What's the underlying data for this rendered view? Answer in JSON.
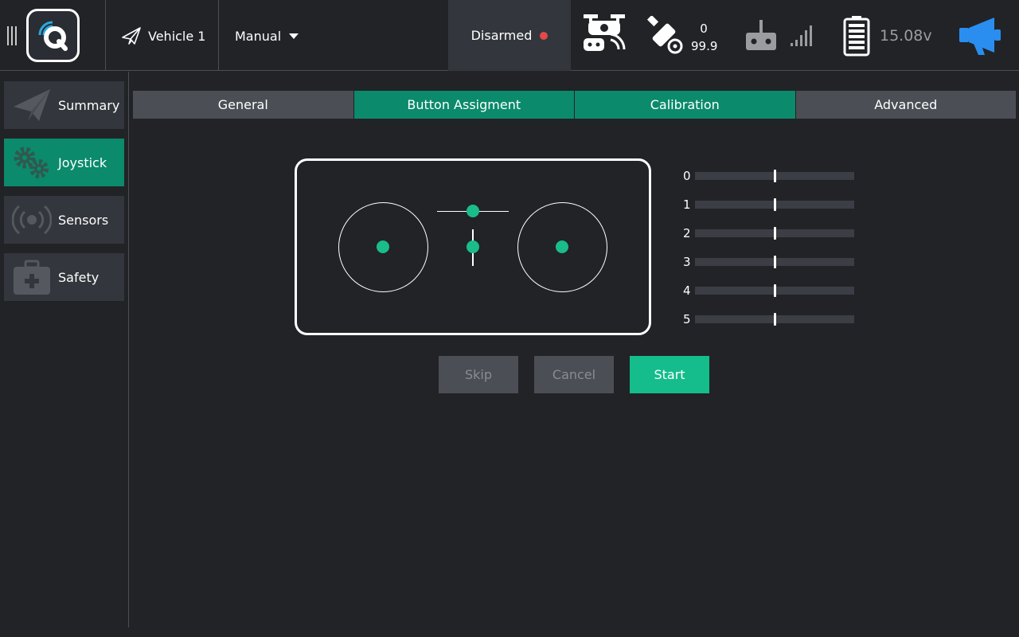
{
  "toolbar": {
    "vehicle_label": "Vehicle 1",
    "mode_label": "Manual",
    "armed_label": "Disarmed",
    "gps_count": "0",
    "gps_hdop": "99.9",
    "battery_voltage": "15.08v",
    "icons": [
      "menu-icon",
      "qgc-logo-icon",
      "paper-plane-icon",
      "dropdown-arrow-icon",
      "status-dot-icon",
      "drone-controller-icon",
      "gps-satellite-icon",
      "rc-transmitter-icon",
      "signal-bars-icon",
      "battery-icon",
      "megaphone-icon"
    ]
  },
  "sidebar": {
    "items": [
      {
        "label": "Summary",
        "icon": "paper-plane-icon",
        "active": false
      },
      {
        "label": "Joystick",
        "icon": "gears-icon",
        "active": true
      },
      {
        "label": "Sensors",
        "icon": "sensor-waves-icon",
        "active": false
      },
      {
        "label": "Safety",
        "icon": "medkit-icon",
        "active": false
      }
    ]
  },
  "tabs": [
    {
      "label": "General",
      "selected": false
    },
    {
      "label": "Button Assigment",
      "selected": true
    },
    {
      "label": "Calibration",
      "selected": true
    },
    {
      "label": "Advanced",
      "selected": false
    }
  ],
  "axes": [
    {
      "label": "0",
      "value": 0.5
    },
    {
      "label": "1",
      "value": 0.5
    },
    {
      "label": "2",
      "value": 0.5
    },
    {
      "label": "3",
      "value": 0.5
    },
    {
      "label": "4",
      "value": 0.5
    },
    {
      "label": "5",
      "value": 0.5
    }
  ],
  "buttons": {
    "skip_label": "Skip",
    "cancel_label": "Cancel",
    "start_label": "Start"
  },
  "colors": {
    "background": "#212327",
    "panel": "#33363c",
    "accent": "#0b8a6c",
    "accent_bright": "#14bd8b",
    "stick_dot": "#1abc8a",
    "disarmed_dot": "#e04a4a",
    "megaphone": "#2a8ef0"
  }
}
